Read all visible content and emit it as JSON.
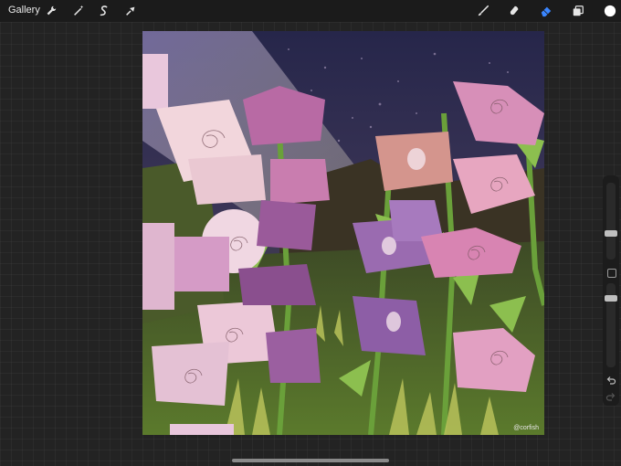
{
  "toolbar": {
    "gallery_label": "Gallery",
    "left_tools": [
      "wrench-icon",
      "magic-wand-icon",
      "selection-icon",
      "transform-arrow-icon"
    ],
    "right_tools": [
      "brush-icon",
      "smudge-icon",
      "eraser-icon",
      "layers-icon",
      "color-swatch"
    ],
    "accent_color": "#3a86ff",
    "current_color": "#ffffff"
  },
  "sidebar": {
    "brush_size_level": 0.32,
    "opacity_level": 0.85
  },
  "artwork": {
    "signature": "@corfish"
  }
}
